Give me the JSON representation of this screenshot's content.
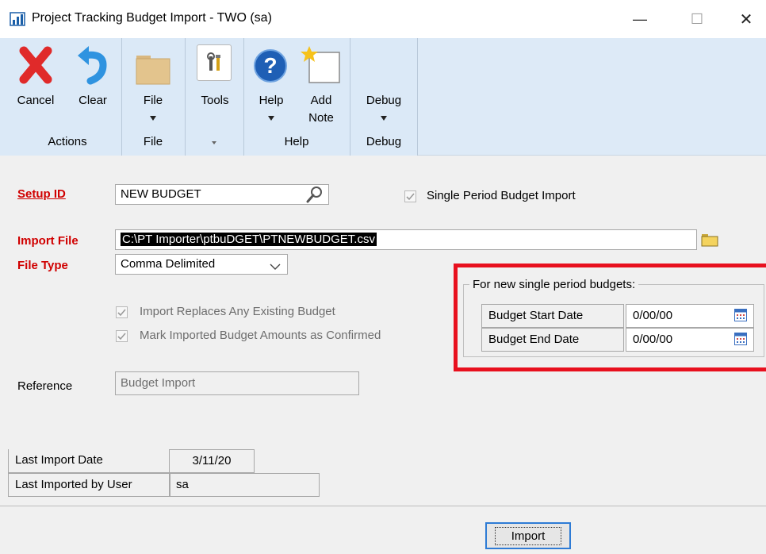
{
  "window": {
    "title": "Project Tracking Budget Import  -  TWO (sa)",
    "minimize_glyph": "—",
    "maximize_glyph": "☐",
    "close_glyph": "✕"
  },
  "ribbon": {
    "buttons": {
      "cancel": "Cancel",
      "clear": "Clear",
      "file": "File",
      "tools": "Tools",
      "help": "Help",
      "add_note_1": "Add",
      "add_note_2": "Note",
      "debug": "Debug"
    },
    "groups": {
      "actions": "Actions",
      "file": "File",
      "help": "Help",
      "debug": "Debug"
    },
    "icons": [
      "cancel-x-icon",
      "undo-arrow-icon",
      "folder-icon",
      "tools-icon",
      "help-question-icon",
      "add-note-icon"
    ]
  },
  "form": {
    "setup_id_label": "Setup ID",
    "setup_id_value": "NEW BUDGET",
    "single_period_label": "Single Period Budget Import",
    "single_period_checked": true,
    "import_file_label": "Import File",
    "import_file_value": "C:\\PT Importer\\ptbuDGET\\PTNEWBUDGET.csv",
    "file_type_label": "File Type",
    "file_type_value": "Comma Delimited",
    "replace_label": "Import Replaces Any Existing Budget",
    "replace_checked": true,
    "confirm_label": "Mark Imported Budget Amounts as Confirmed",
    "confirm_checked": true,
    "reference_label": "Reference",
    "reference_value": "Budget Import",
    "last_import_date_label": "Last Import Date",
    "last_import_date_value": "3/11/20",
    "last_user_label": "Last Imported by User",
    "last_user_value": "sa"
  },
  "single_period": {
    "group_title": "For new single period budgets:",
    "start_label": "Budget Start Date",
    "start_value": "0/00/00",
    "end_label": "Budget End Date",
    "end_value": "0/00/00"
  },
  "footer": {
    "import_button": "Import"
  },
  "colors": {
    "required_label": "#d00000",
    "highlight": "#e8101e",
    "ribbon_bg": "#dbe9f7",
    "selection": "#000000"
  }
}
